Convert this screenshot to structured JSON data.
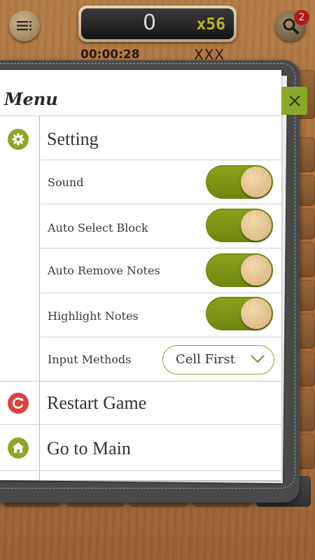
{
  "header": {
    "score": "0",
    "combo": "x56",
    "timer": "00:00:28",
    "mistakes": "XXX",
    "notification_count": "2"
  },
  "menu": {
    "title": "Menu",
    "setting_label": "Setting",
    "options": {
      "sound": {
        "label": "Sound",
        "on": true
      },
      "auto_select_block": {
        "label": "Auto Select Block",
        "on": true
      },
      "auto_remove_notes": {
        "label": "Auto Remove Notes",
        "on": true
      },
      "highlight_notes": {
        "label": "Highlight Notes",
        "on": true
      }
    },
    "input_methods": {
      "label": "Input Methods",
      "value": "Cell First"
    },
    "restart_label": "Restart Game",
    "main_label": "Go to Main"
  },
  "colors": {
    "accent_green": "#8aa828",
    "restart_red": "#d9443f"
  },
  "icons": [
    "menu-icon",
    "search-icon",
    "close-icon",
    "gear-icon",
    "restart-icon",
    "home-icon",
    "chevron-down-icon"
  ]
}
